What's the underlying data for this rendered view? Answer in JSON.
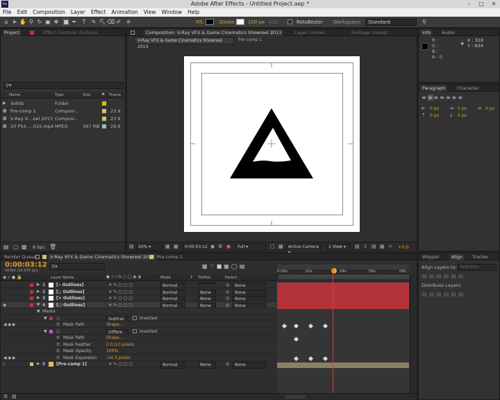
{
  "app": {
    "title": "Adobe After Effects - Untitled Project.aep *",
    "logo": "Ae"
  },
  "menu": [
    "File",
    "Edit",
    "Composition",
    "Layer",
    "Effect",
    "Animation",
    "View",
    "Window",
    "Help"
  ],
  "toolbar": {
    "fill_label": "Fill:",
    "stroke_label": "Stroke:",
    "stroke_value": "100 px",
    "add_label": "Add:",
    "rotobezier_label": "RotoBezier",
    "workspace_label": "Workspace:",
    "workspace_value": "Standard"
  },
  "project": {
    "tab_project": "Project",
    "tab_effect_controls": "Effect Controls: Outlines",
    "columns": {
      "name": "Name",
      "type": "Type",
      "size": "Size",
      "frame": "Frame ..."
    },
    "items": [
      {
        "name": "Solids",
        "type": "Folder",
        "size": "",
        "frame": "",
        "color": "#d7c21d",
        "icon": "folder-icon"
      },
      {
        "name": "Pre-comp 1",
        "type": "Composi...",
        "size": "",
        "frame": "23.9",
        "color": "#d2c26e",
        "icon": "composition-icon"
      },
      {
        "name": "V-Ray V....eel 2013",
        "type": "Composi...",
        "size": "",
        "frame": "23.9",
        "color": "#d2c26e",
        "icon": "composition-icon"
      },
      {
        "name": "20 PS4 ....015.mp4",
        "type": "MPEG",
        "size": "367 MB",
        "frame": "29.9",
        "color": "#9fb4c9",
        "icon": "footage-icon"
      }
    ],
    "bpc": "8 bpc"
  },
  "composition": {
    "tab_title": "Composition: V-Ray VFX & Game Cinematics Showreel 2013",
    "layer_tab": "Layer: (none)",
    "footage_tab": "Footage: (none)",
    "breadcrumb_1": "V-Ray VFX & Game Cinematics Showreel 2013",
    "breadcrumb_2": "Pre-comp 1",
    "zoom": "50%",
    "time": "0:00:03:12",
    "resolution": "Full",
    "camera": "Active Camera",
    "view": "1 View",
    "exposure": "+0.0"
  },
  "info": {
    "tab_info": "Info",
    "tab_audio": "Audio",
    "r": "R :",
    "g": "G :",
    "b": "B :",
    "a": "A : 0",
    "x": "X : 316",
    "y": "Y : 934"
  },
  "paragraph": {
    "tab_paragraph": "Paragraph",
    "tab_character": "Character",
    "values": [
      "0 px",
      "0 px",
      "0 px",
      "0 px",
      "0 px"
    ]
  },
  "timeline": {
    "tab_render_queue": "Render Queue",
    "tab_comp": "V-Ray VFX & Game Cinematics Showreel 2013",
    "tab_precomp": "Pre-comp 1",
    "timecode": "0:00:03:12",
    "frame_info": "00084 (23.976 fps)",
    "columns": {
      "layer_name": "Layer Name",
      "mode": "Mode",
      "t": "T",
      "trkmat": "TrkMat",
      "parent": "Parent"
    },
    "ruler_labels": [
      "0:00s",
      "02s",
      "04s",
      "06s",
      "08s"
    ],
    "layers": [
      {
        "num": "1",
        "name": "[∘ Outlines]",
        "mode": "Normal",
        "trkmat": "",
        "parent": "None"
      },
      {
        "num": "2",
        "name": "[△ Outlines]",
        "mode": "Normal",
        "trkmat": "None",
        "parent": "None"
      },
      {
        "num": "3",
        "name": "[✕ Outlines]",
        "mode": "Normal",
        "trkmat": "None",
        "parent": "None"
      },
      {
        "num": "4",
        "name": "[○ Outlines]",
        "mode": "Normal",
        "trkmat": "None",
        "parent": "None"
      }
    ],
    "masks_label": "Masks",
    "mask1": {
      "mode": "Subtrac",
      "inverted": "Inverted",
      "path_label": "Mask Path",
      "path_value": "Shape..."
    },
    "mask2": {
      "mode": "Differe",
      "inverted": "Inverted",
      "path_label": "Mask Path",
      "path_value": "Shape...",
      "feather_label": "Mask Feather",
      "feather_value": "0.0,0.0 pixels",
      "opacity_label": "Mask Opacity",
      "opacity_value": "100%",
      "expansion_label": "Mask Expansion",
      "expansion_value": "-14.3 pixels"
    },
    "layer5": {
      "num": "5",
      "name": "[Pre-comp 1]",
      "mode": "Normal",
      "trkmat": "None",
      "parent": "None"
    }
  },
  "right_panels": {
    "tab_wiggler": "Wiggler",
    "tab_align": "Align",
    "tab_tracker": "Tracker",
    "align_layers_to": "Align Layers to:",
    "align_target": "Selection",
    "distribute_layers": "Distribute Layers:"
  }
}
